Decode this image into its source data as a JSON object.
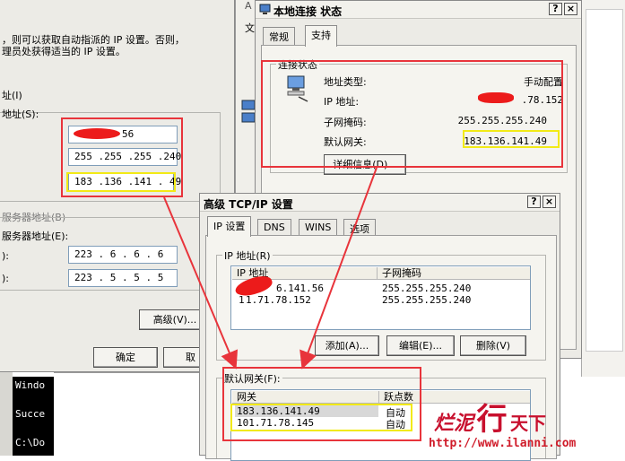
{
  "left_dialog": {
    "desc_line1": "，则可以获取自动指派的 IP 设置。否则，",
    "desc_line2": "理员处获得适当的 IP 设置。",
    "ip_address_label": "址(I)",
    "ip_addr_label2": "地址(S):",
    "ip_value": " .141 . 56",
    "mask_value": "255 .255 .255 .240",
    "gateway_value": "183 .136 .141 . 49",
    "dns_section_label": "服务器地址(B)",
    "dns_pref_label": "服务器地址(E):",
    "dns_alt_label": "):",
    "dns_pref_prefix": "):",
    "dns1": "223 . 6 . 6 . 6",
    "dns2": "223 . 5 . 5 . 5",
    "advanced_button": "高级(V)...",
    "ok_button": "确定",
    "cancel_partial": "取"
  },
  "background_strip": {
    "top_label": "文",
    "a_label": "A"
  },
  "status_dialog": {
    "title": "本地连接 状态",
    "help_btn": "?",
    "close_btn": "×",
    "tabs": [
      "常规",
      "支持"
    ],
    "group_label": "连接状态",
    "rows": [
      {
        "label": "地址类型:",
        "value": "手动配置"
      },
      {
        "label": "IP 地址:",
        "value": ".78.152"
      },
      {
        "label": "子网掩码:",
        "value": "255.255.255.240"
      },
      {
        "label": "默认网关:",
        "value": "183.136.141.49"
      }
    ],
    "details_button": "详细信息(D)..."
  },
  "tcpip_dialog": {
    "title": "高级 TCP/IP 设置",
    "help_btn": "?",
    "close_btn": "×",
    "tabs": [
      "IP 设置",
      "DNS",
      "WINS",
      "选项"
    ],
    "ip_group_label": "IP 地址(R)",
    "ip_columns": [
      "IP 地址",
      "子网掩码"
    ],
    "ip_rows": [
      {
        "ip": "6.141.56",
        "mask": "255.255.255.240"
      },
      {
        "ip": "1.71.78.152",
        "mask": "255.255.255.240"
      }
    ],
    "ip_prefix1": "1",
    "add_button": "添加(A)...",
    "edit_button": "编辑(E)...",
    "delete_button": "删除(V)",
    "gateway_group_label": "默认网关(F):",
    "gw_columns": [
      "网关",
      "跃点数"
    ],
    "gw_rows": [
      {
        "gateway": "183.136.141.49",
        "metric": "自动"
      },
      {
        "gateway": "101.71.78.145",
        "metric": "自动"
      }
    ]
  },
  "console": {
    "lines": [
      "Windo",
      "Succe",
      "C:\\Do"
    ]
  },
  "watermark": {
    "brand": "烂泥行天下",
    "brand_part1": "烂泥",
    "brand_part2": "行",
    "brand_part3": "天下",
    "url": "http://www.ilanni.com"
  },
  "colors": {
    "highlight_red": "#e8343b",
    "highlight_yellow": "#f2ea16",
    "dialog_bg": "#ecebe6"
  }
}
